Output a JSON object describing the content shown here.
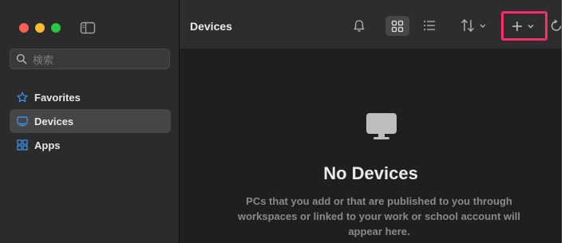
{
  "sidebar": {
    "search": {
      "placeholder": "検索",
      "value": ""
    },
    "items": [
      {
        "label": "Favorites",
        "icon": "star-icon",
        "active": false
      },
      {
        "label": "Devices",
        "icon": "monitor-icon",
        "active": true
      },
      {
        "label": "Apps",
        "icon": "apps-grid-icon",
        "active": false
      }
    ]
  },
  "header": {
    "title": "Devices",
    "toolbar": [
      "bell-icon",
      "grid-view-icon",
      "list-view-icon",
      "sort-icon",
      "add-icon",
      "refresh-icon"
    ]
  },
  "empty_state": {
    "title": "No Devices",
    "description": "PCs that you add or that are published to you through workspaces or linked to your work or school account will appear here."
  },
  "colors": {
    "accent": "#3b8eea",
    "highlight_border": "#ff2d6b",
    "traffic_red": "#ff5f57",
    "traffic_yellow": "#febc2e",
    "traffic_green": "#28c840"
  }
}
